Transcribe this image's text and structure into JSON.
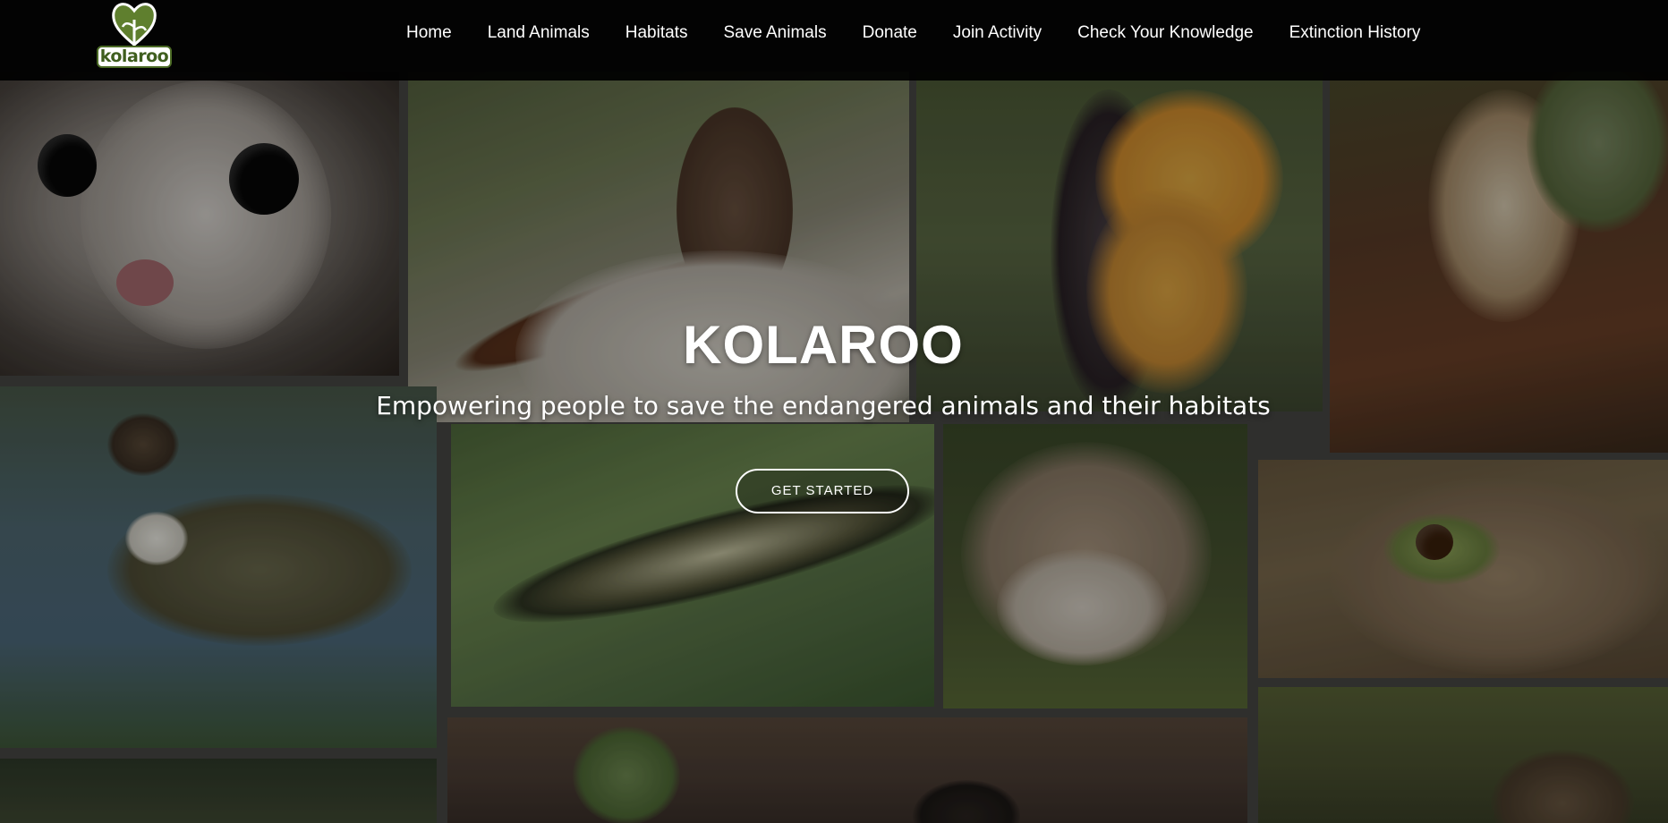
{
  "brand": {
    "name": "kolaroo",
    "logo_color": "#4b6a25"
  },
  "nav": {
    "items": [
      {
        "label": "Home"
      },
      {
        "label": "Land Animals"
      },
      {
        "label": "Habitats"
      },
      {
        "label": "Save Animals"
      },
      {
        "label": "Donate"
      },
      {
        "label": "Join Activity"
      },
      {
        "label": "Check Your Knowledge"
      },
      {
        "label": "Extinction History"
      }
    ]
  },
  "hero": {
    "title": "KOLAROO",
    "subtitle": "Empowering people to save the endangered animals and their habitats",
    "cta_label": "GET STARTED"
  },
  "collage": {
    "tiles": [
      "possum-photo",
      "wallaby-photo",
      "moth-photo",
      "quail-photo",
      "snipe-photo",
      "lizard-photo",
      "bandicoot-photo",
      "frog-photo",
      "bird-photo",
      "flower-bird-photo",
      "quail-bird-photo"
    ]
  }
}
